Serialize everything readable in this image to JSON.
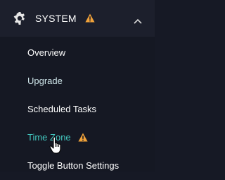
{
  "header": {
    "title": "SYSTEM",
    "icon": "gear-icon",
    "warning_icon": "warning-icon",
    "chevron_icon": "chevron-up-icon"
  },
  "submenu": {
    "items": [
      {
        "label": "Overview"
      },
      {
        "label": "Upgrade"
      },
      {
        "label": "Scheduled Tasks"
      },
      {
        "label": "Time Zone",
        "active": true,
        "warning_icon": "warning-icon"
      },
      {
        "label": "Toggle Button Settings"
      }
    ]
  },
  "colors": {
    "background": "#161925",
    "header_background": "#1c1f2c",
    "text": "#ffffff",
    "active_text": "#43c7bf",
    "warning": "#f0a23a"
  }
}
